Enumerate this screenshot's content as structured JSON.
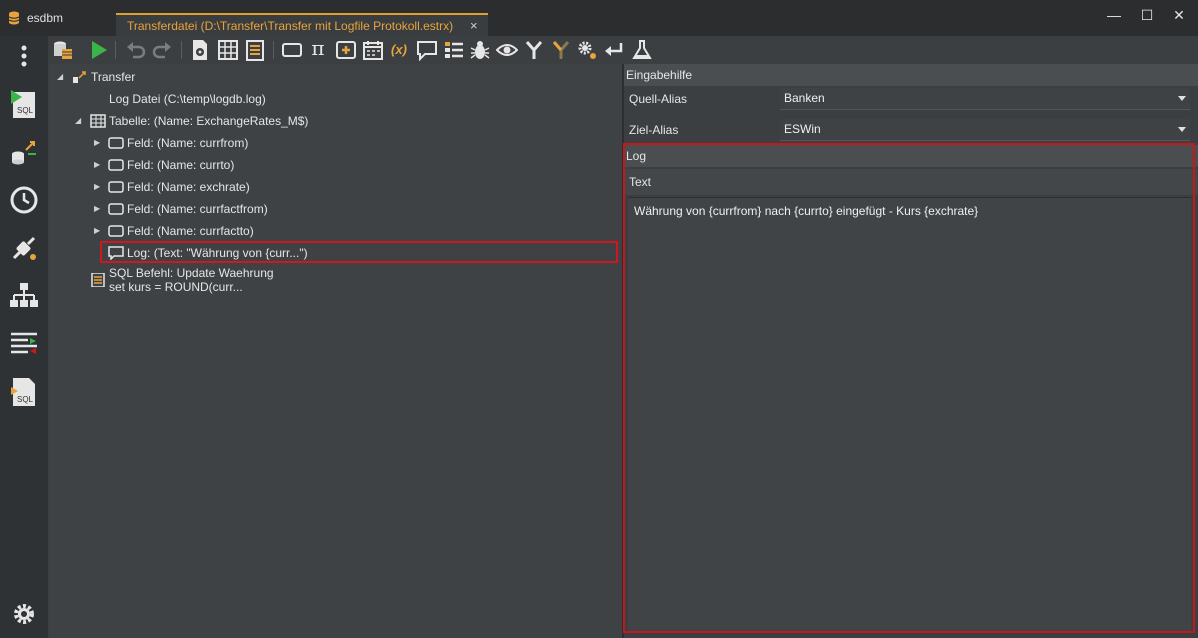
{
  "app": {
    "title": "esdbm"
  },
  "tab": {
    "title": "Transferdatei (D:\\Transfer\\Transfer mit Logfile Protokoll.estrx)",
    "close": "×"
  },
  "window": {
    "minimize": "—",
    "maximize": "☐",
    "close": "✕"
  },
  "sidebar": {
    "items": [
      {
        "name": "more-menu-icon"
      },
      {
        "name": "sql-run-icon",
        "label": "SQL"
      },
      {
        "name": "db-transfer-icon"
      },
      {
        "name": "history-clock-icon"
      },
      {
        "name": "plugin-connection-icon"
      },
      {
        "name": "hierarchy-icon"
      },
      {
        "name": "compare-lists-icon"
      },
      {
        "name": "sql-file-icon",
        "label": "SQL"
      },
      {
        "name": "settings-gear-icon"
      }
    ]
  },
  "toolbar": {
    "icons": [
      "database-table-icon",
      "run-icon",
      "undo-icon",
      "redo-icon",
      "file-gear-icon",
      "table-grid-icon",
      "list-note-icon",
      "field-box-icon",
      "pi-icon",
      "add-field-icon",
      "calendar-icon",
      "variable-icon",
      "comment-icon",
      "list-items-icon",
      "bug-icon",
      "eye-icon",
      "merge-branch-icon",
      "split-branch-icon",
      "settings-gears-icon",
      "return-icon",
      "flask-icon"
    ],
    "pi": "π",
    "var": "(x)"
  },
  "tree": {
    "root": "Transfer",
    "logfile": "Log Datei (C:\\temp\\logdb.log)",
    "table": "Tabelle: (Name: ExchangeRates_M$)",
    "fields": [
      "Feld: (Name: currfrom)",
      "Feld: (Name: currto)",
      "Feld: (Name: exchrate)",
      "Feld: (Name: currfactfrom)",
      "Feld: (Name: currfactto)"
    ],
    "log": "Log: (Text: \"Währung von {curr...\")",
    "sql_line1": "SQL Befehl: Update Waehrung",
    "sql_line2": "set kurs = ROUND(curr..."
  },
  "props": {
    "header": "Eingabehilfe",
    "quell_label": "Quell-Alias",
    "quell_value": "Banken",
    "ziel_label": "Ziel-Alias",
    "ziel_value": "ESWin",
    "log_header": "Log",
    "text_label": "Text",
    "text_value": "Währung von {currfrom} nach {currto} eingefügt - Kurs {exchrate}"
  },
  "colors": {
    "accent_tab": "#e8a33c",
    "highlight_border": "#d0161f",
    "run_green": "#3bb54a"
  }
}
